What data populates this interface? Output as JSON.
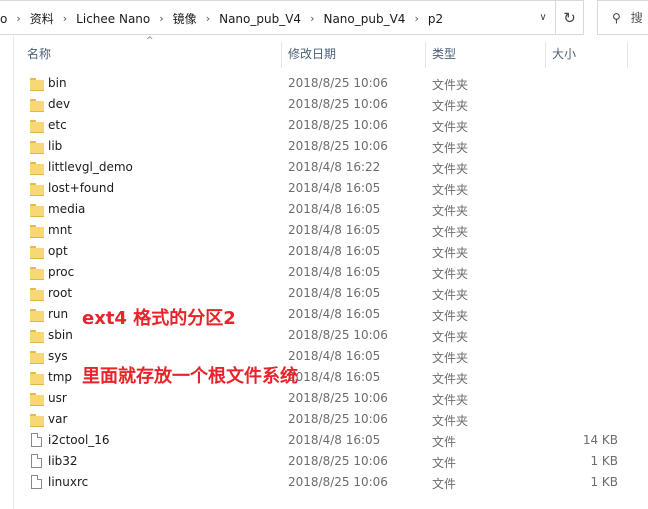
{
  "address_bar": {
    "crumbs": [
      "o",
      "资料",
      "Lichee Nano",
      "镜像",
      "Nano_pub_V4",
      "Nano_pub_V4",
      "p2"
    ],
    "separator": "›",
    "dropdown_glyph": "∨",
    "refresh_glyph": "↻",
    "search_glyph": "⚲",
    "search_placeholder": "搜"
  },
  "columns": {
    "name": "名称",
    "modified": "修改日期",
    "type": "类型",
    "size": "大小",
    "sort_glyph": "^"
  },
  "files": [
    {
      "name": "bin",
      "modified": "2018/8/25 10:06",
      "type": "文件夹",
      "size": "",
      "kind": "folder"
    },
    {
      "name": "dev",
      "modified": "2018/8/25 10:06",
      "type": "文件夹",
      "size": "",
      "kind": "folder"
    },
    {
      "name": "etc",
      "modified": "2018/8/25 10:06",
      "type": "文件夹",
      "size": "",
      "kind": "folder"
    },
    {
      "name": "lib",
      "modified": "2018/8/25 10:06",
      "type": "文件夹",
      "size": "",
      "kind": "folder"
    },
    {
      "name": "littlevgl_demo",
      "modified": "2018/4/8 16:22",
      "type": "文件夹",
      "size": "",
      "kind": "folder"
    },
    {
      "name": "lost+found",
      "modified": "2018/4/8 16:05",
      "type": "文件夹",
      "size": "",
      "kind": "folder"
    },
    {
      "name": "media",
      "modified": "2018/4/8 16:05",
      "type": "文件夹",
      "size": "",
      "kind": "folder"
    },
    {
      "name": "mnt",
      "modified": "2018/4/8 16:05",
      "type": "文件夹",
      "size": "",
      "kind": "folder"
    },
    {
      "name": "opt",
      "modified": "2018/4/8 16:05",
      "type": "文件夹",
      "size": "",
      "kind": "folder"
    },
    {
      "name": "proc",
      "modified": "2018/4/8 16:05",
      "type": "文件夹",
      "size": "",
      "kind": "folder"
    },
    {
      "name": "root",
      "modified": "2018/4/8 16:05",
      "type": "文件夹",
      "size": "",
      "kind": "folder"
    },
    {
      "name": "run",
      "modified": "2018/4/8 16:05",
      "type": "文件夹",
      "size": "",
      "kind": "folder"
    },
    {
      "name": "sbin",
      "modified": "2018/8/25 10:06",
      "type": "文件夹",
      "size": "",
      "kind": "folder"
    },
    {
      "name": "sys",
      "modified": "2018/4/8 16:05",
      "type": "文件夹",
      "size": "",
      "kind": "folder"
    },
    {
      "name": "tmp",
      "modified": "2018/4/8 16:05",
      "type": "文件夹",
      "size": "",
      "kind": "folder"
    },
    {
      "name": "usr",
      "modified": "2018/8/25 10:06",
      "type": "文件夹",
      "size": "",
      "kind": "folder"
    },
    {
      "name": "var",
      "modified": "2018/8/25 10:06",
      "type": "文件夹",
      "size": "",
      "kind": "folder"
    },
    {
      "name": "i2ctool_16",
      "modified": "2018/4/8 16:05",
      "type": "文件",
      "size": "14 KB",
      "kind": "file"
    },
    {
      "name": "lib32",
      "modified": "2018/8/25 10:06",
      "type": "文件",
      "size": "1 KB",
      "kind": "file"
    },
    {
      "name": "linuxrc",
      "modified": "2018/8/25 10:06",
      "type": "文件",
      "size": "1 KB",
      "kind": "file"
    }
  ],
  "annotations": {
    "line1": "ext4 格式的分区2",
    "line2": "里面就存放一个根文件系统",
    "color": "#e8242a"
  },
  "colors": {
    "folder": "#f8d775",
    "header_text": "#4c607a"
  }
}
